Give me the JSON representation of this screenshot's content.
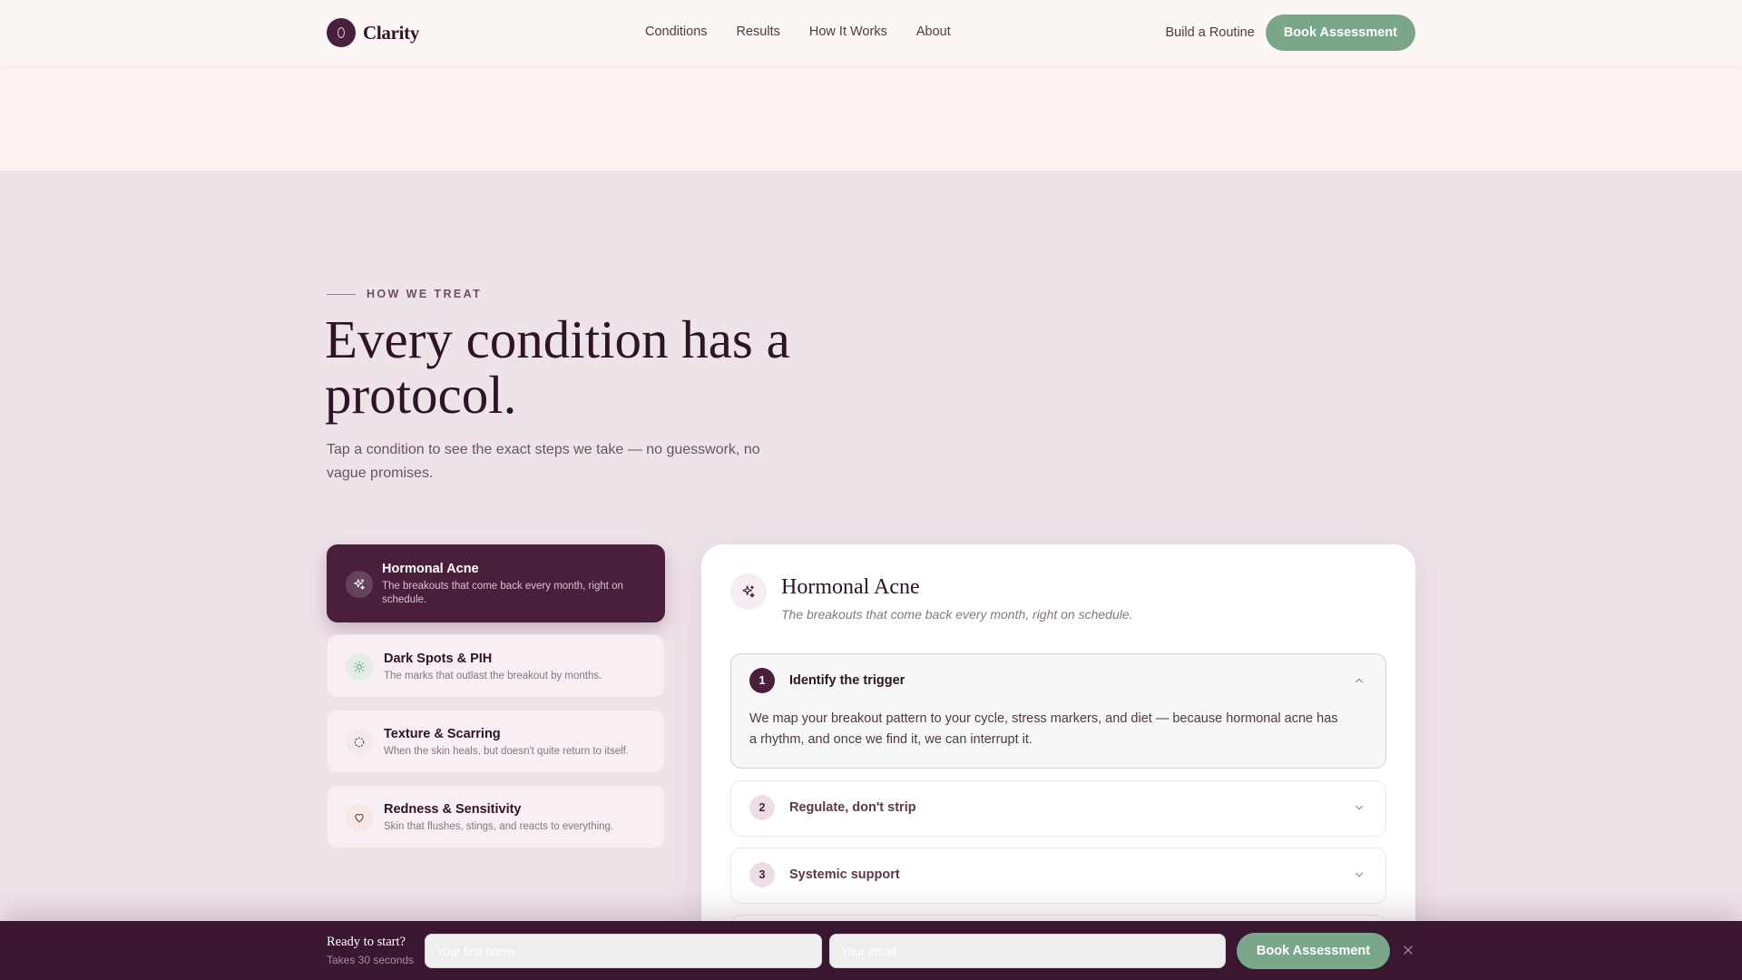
{
  "header": {
    "brand": "Clarity",
    "nav": [
      "Conditions",
      "Results",
      "How It Works",
      "About"
    ],
    "routine_link": "Build a Routine",
    "cta": "Book Assessment"
  },
  "section": {
    "eyebrow": "HOW WE TREAT",
    "headline": "Every condition has a protocol.",
    "subhead": "Tap a condition to see the exact steps we take — no guesswork, no vague promises."
  },
  "conditions": [
    {
      "title": "Hormonal Acne",
      "desc": "The breakouts that come back every month, right on schedule.",
      "icon": "sparkle-icon",
      "active": true
    },
    {
      "title": "Dark Spots & PIH",
      "desc": "The marks that outlast the breakout by months.",
      "icon": "sun-icon",
      "active": false
    },
    {
      "title": "Texture & Scarring",
      "desc": "When the skin heals, but doesn't quite return to itself.",
      "icon": "dotted-circle-icon",
      "active": false
    },
    {
      "title": "Redness & Sensitivity",
      "desc": "Skin that flushes, stings, and reacts to everything.",
      "icon": "heart-icon",
      "active": false
    }
  ],
  "detail": {
    "title": "Hormonal Acne",
    "subtitle": "The breakouts that come back every month, right on schedule.",
    "steps": [
      {
        "num": "1",
        "title": "Identify the trigger",
        "body": "We map your breakout pattern to your cycle, stress markers, and diet — because hormonal acne has a rhythm, and once we find it, we can interrupt it.",
        "open": true
      },
      {
        "num": "2",
        "title": "Regulate, don't strip",
        "open": false
      },
      {
        "num": "3",
        "title": "Systemic support",
        "open": false
      }
    ]
  },
  "bottom_bar": {
    "title": "Ready to start?",
    "subtitle": "Takes 30 seconds",
    "name_placeholder": "Your first name",
    "email_placeholder": "Your email",
    "cta": "Book Assessment"
  },
  "colors": {
    "plum": "#4a1f3c",
    "sage": "#7aa78a",
    "blush_bg": "#efe3ea",
    "cream": "#fcf7f4"
  }
}
